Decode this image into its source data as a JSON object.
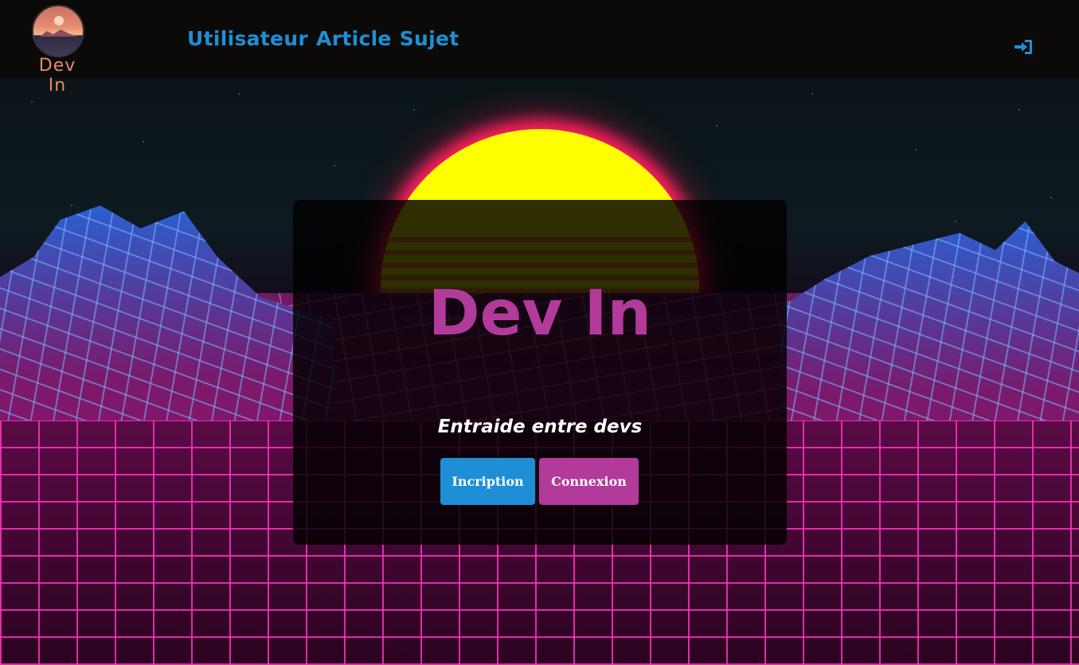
{
  "header": {
    "logo_text": "Dev In",
    "nav": [
      {
        "label": "Utilisateur"
      },
      {
        "label": "Article"
      },
      {
        "label": "Sujet"
      }
    ],
    "login_icon": "sign-in-icon"
  },
  "hero": {
    "title": "Dev In",
    "subtitle": "Entraide entre devs",
    "register_label": "Incription",
    "login_label": "Connexion"
  },
  "colors": {
    "accent_blue": "#1e8fd6",
    "accent_magenta": "#b23a9b",
    "logo_orange": "#e58a67",
    "header_bg": "#0b0a09"
  }
}
